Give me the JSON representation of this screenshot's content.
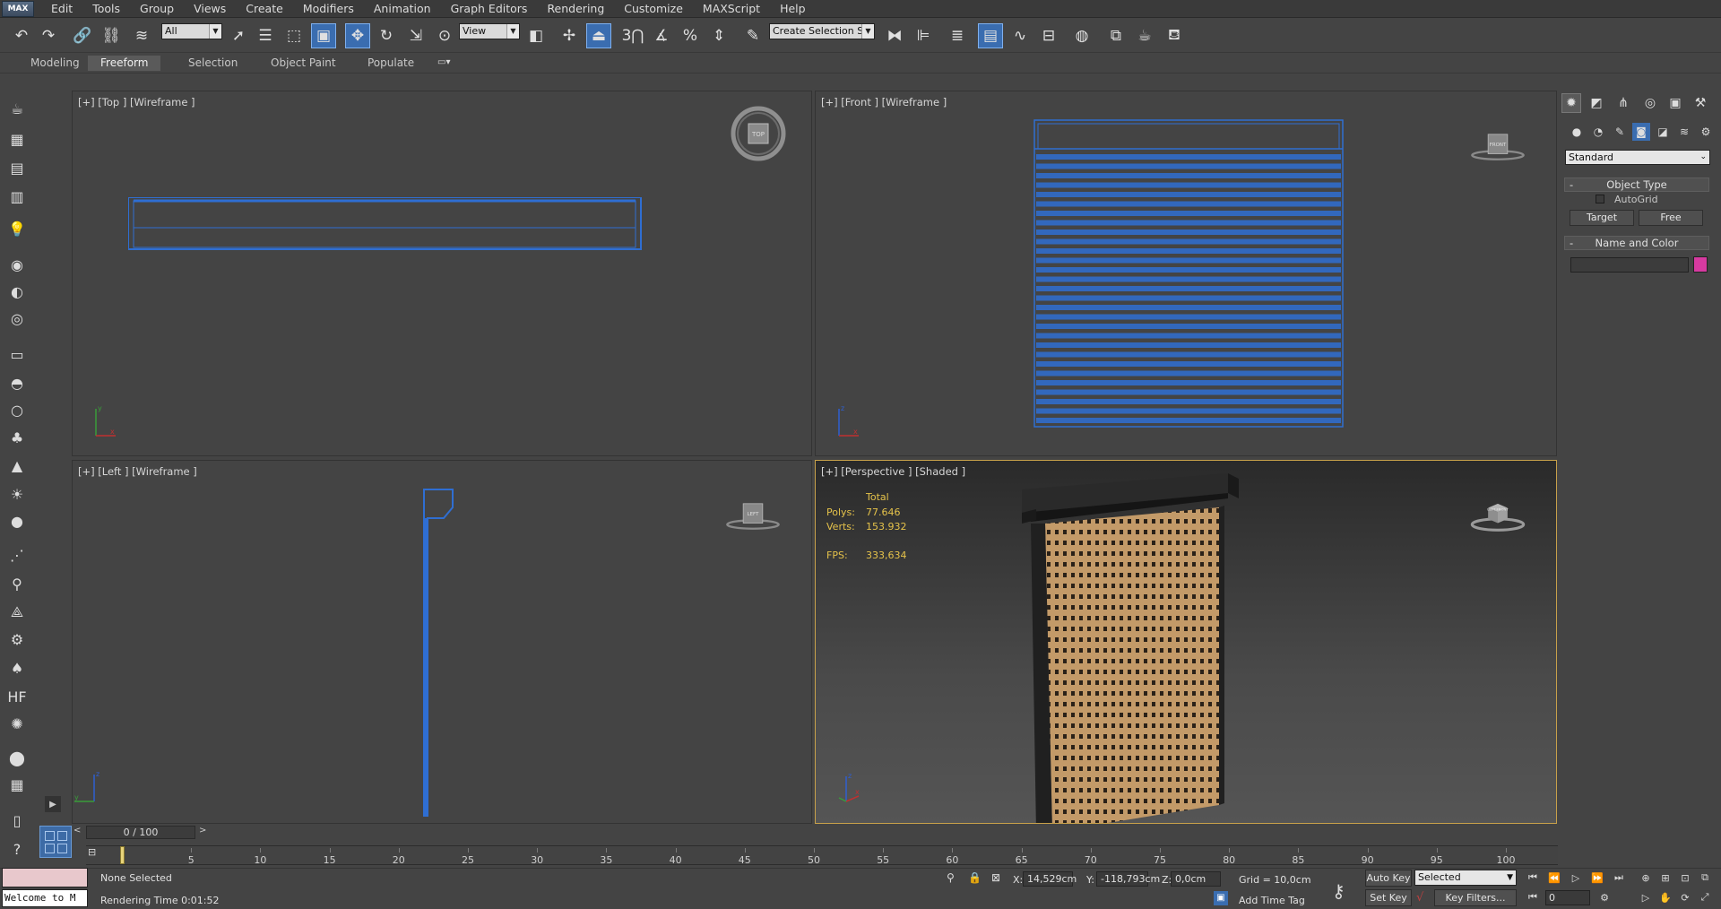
{
  "menubar": {
    "logo": "MAX",
    "items": [
      "Edit",
      "Tools",
      "Group",
      "Views",
      "Create",
      "Modifiers",
      "Animation",
      "Graph Editors",
      "Rendering",
      "Customize",
      "MAXScript",
      "Help"
    ]
  },
  "toolbar": {
    "selection_filter": "All",
    "reference_coord": "View",
    "named_selection": "Create Selection Se",
    "icons": [
      "undo-icon",
      "redo-icon",
      "link-icon",
      "unlink-icon",
      "bind-spacewarp-icon",
      "select-object-icon",
      "select-by-name-icon",
      "rect-selection-icon",
      "window-crossing-icon",
      "move-icon",
      "rotate-icon",
      "scale-icon",
      "select-place-icon",
      "pivot-icon",
      "manipulate-icon",
      "snaps-toggle-icon",
      "angle-snap-icon",
      "percent-snap-icon",
      "spinner-snap-icon",
      "edit-named-sets-icon",
      "mirror-icon",
      "align-icon",
      "layer-explorer-icon",
      "scene-explorer-icon",
      "curve-editor-icon",
      "schematic-view-icon",
      "material-editor-icon",
      "render-setup-icon",
      "rendered-frame-icon",
      "render-production-icon"
    ]
  },
  "ribbon": {
    "tabs": [
      "Modeling",
      "Freeform",
      "Selection",
      "Object Paint",
      "Populate"
    ],
    "active_tab": "Freeform"
  },
  "viewports": {
    "top": {
      "label": "[+] [Top ] [Wireframe ]",
      "cube": "TOP"
    },
    "front": {
      "label": "[+] [Front ] [Wireframe ]",
      "cube": "FRONT"
    },
    "left": {
      "label": "[+] [Left ] [Wireframe ]",
      "cube": "LEFT"
    },
    "perspective": {
      "label": "[+] [Perspective ] [Shaded ]",
      "cube": "LEFT FRONT",
      "stats": {
        "header": "Total",
        "polys_label": "Polys:",
        "polys_value": "77.646",
        "verts_label": "Verts:",
        "verts_value": "153.932",
        "fps_label": "FPS:",
        "fps_value": "333,634"
      }
    }
  },
  "command_panel": {
    "dropdown": "Standard",
    "object_type": {
      "title": "Object Type",
      "autogrid": "AutoGrid",
      "autogrid_checked": false,
      "buttons": [
        "Target",
        "Free"
      ]
    },
    "name_and_color": {
      "title": "Name and Color",
      "name_value": "",
      "color": "#d63aa0"
    }
  },
  "timeline": {
    "frame_indicator": "0 / 100",
    "ticks": [
      0,
      5,
      10,
      15,
      20,
      25,
      30,
      35,
      40,
      45,
      50,
      55,
      60,
      65,
      70,
      75,
      80,
      85,
      90,
      95,
      100
    ],
    "tick_labels": [
      "5",
      "10",
      "15",
      "20",
      "25",
      "30",
      "35",
      "40",
      "45",
      "50",
      "55",
      "60",
      "65",
      "70",
      "75",
      "80",
      "85",
      "90",
      "95",
      "100"
    ],
    "current_frame": 0
  },
  "status": {
    "maxscript_listener": "Welcome to M",
    "selection": "None Selected",
    "rendering_time": "Rendering Time  0:01:52",
    "x_label": "X:",
    "x_value": "14,529cm",
    "y_label": "Y:",
    "y_value": "-118,793cm",
    "z_label": "Z:",
    "z_value": "0,0cm",
    "grid": "Grid = 10,0cm",
    "add_time_tag": "Add Time Tag",
    "auto_key": "Auto Key",
    "set_key": "Set Key",
    "selected": "Selected",
    "key_filters": "Key Filters...",
    "frame_value": "0"
  },
  "colors": {
    "wire_blue": "#2f6ed2",
    "active_border": "#c8a14a",
    "stats_yellow": "#e5c24a",
    "panel_tan": "#c39a68",
    "panel_frame": "#1e1e1e"
  }
}
